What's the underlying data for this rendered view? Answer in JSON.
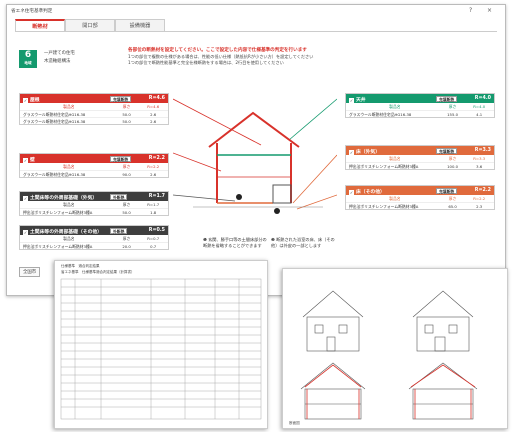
{
  "window": {
    "title": "省エネ住宅基準判定",
    "help": "?",
    "close": "×"
  },
  "tabs": [
    {
      "label": "断熱材",
      "active": true
    },
    {
      "label": "開口部",
      "active": false
    },
    {
      "label": "設備機器",
      "active": false
    }
  ],
  "grade": {
    "number": "6",
    "unit": "地域"
  },
  "meta": {
    "line1": "一戸建ての住宅",
    "line2": "木造軸組構法"
  },
  "info": {
    "headline": "各部位の断熱材を設定してください。ここで設定した内容で仕様基準の判定を行います",
    "line1": "1つの部位で複数の仕様がある場合は、性能の低い仕様（熱抵抗Rが小さい方）を設定してください",
    "line2": "1つの部位で断熱性能基準と完全仕様断熱をする場合は、2行目を使用してください"
  },
  "columns": {
    "name": "製品名",
    "thickness": "厚さ",
    "r": "R="
  },
  "panels": [
    {
      "id": "roof-beam",
      "title": "屋根",
      "select": "充填断熱",
      "r_value": "R=4.6",
      "color": "#d8322b",
      "req": [
        "",
        "",
        "R=4.6"
      ],
      "rows": [
        [
          "グラスウール断熱材住宅品HG16-38",
          "50.0",
          "2.6"
        ],
        [
          "グラスウール断熱材住宅品HG16-38",
          "50.0",
          "2.6"
        ]
      ]
    },
    {
      "id": "wall",
      "title": "壁",
      "select": "充填断熱",
      "r_value": "R=2.2",
      "color": "#d8322b",
      "req": [
        "",
        "",
        "R=2.2"
      ],
      "rows": [
        [
          "グラスウール断熱材住宅品HG16-38",
          "90.0",
          "2.6"
        ]
      ]
    },
    {
      "id": "ground-exterior",
      "title": "土間床等の外周部基礎（外気）",
      "select": "外断熱",
      "r_value": "R=1.7",
      "color": "#3e3e3e",
      "req": [
        "",
        "",
        "R=1.7"
      ],
      "rows": [
        [
          "押出法ポリスチレンフォーム断熱材3種A",
          "50.0",
          "1.8"
        ]
      ]
    },
    {
      "id": "ground-other",
      "title": "土間床等の外周部基礎（その他）",
      "select": "外断熱",
      "r_value": "R=0.5",
      "color": "#3e3e3e",
      "req": [
        "",
        "",
        "R=0.7"
      ],
      "rows": [
        [
          "押出法ポリスチレンフォーム断熱材3種A",
          "20.0",
          "0.7"
        ]
      ]
    },
    {
      "id": "ceiling",
      "title": "天井",
      "select": "充填断熱",
      "r_value": "R=4.0",
      "color": "#149a6e",
      "req": [
        "",
        "",
        "R=4.0"
      ],
      "rows": [
        [
          "グラスウール断熱材住宅品HG16-38",
          "155.0",
          "4.1"
        ]
      ]
    },
    {
      "id": "floor-exterior",
      "title": "床（外気）",
      "select": "充填断熱",
      "r_value": "R=3.3",
      "color": "#e06a3c",
      "req": [
        "",
        "",
        "R=3.3"
      ],
      "rows": [
        [
          "押出法ポリスチレンフォーム断熱材3種A",
          "100.0",
          "3.6"
        ]
      ]
    },
    {
      "id": "floor-other",
      "title": "床（その他）",
      "select": "充填断熱",
      "r_value": "R=2.2",
      "color": "#e06a3c",
      "req": [
        "",
        "",
        "R=2.2"
      ],
      "rows": [
        [
          "押出法ポリスチレンフォーム断熱材3種A",
          "65.0",
          "2.3"
        ]
      ]
    }
  ],
  "notes": {
    "note1": "❶ 玄関、勝手口等の土間床部分の断熱を省略することができます",
    "note2": "❷ 断熱された浴室の床、床（その他）は外皮の一部とします"
  },
  "footer": {
    "button": "全国市"
  },
  "doc1": {
    "title": "仕様基準　適合判定結果",
    "subtitle": "省エネ基準　仕様基準適合判定結果（計算書）"
  },
  "doc2": {
    "caption": "断面図"
  }
}
